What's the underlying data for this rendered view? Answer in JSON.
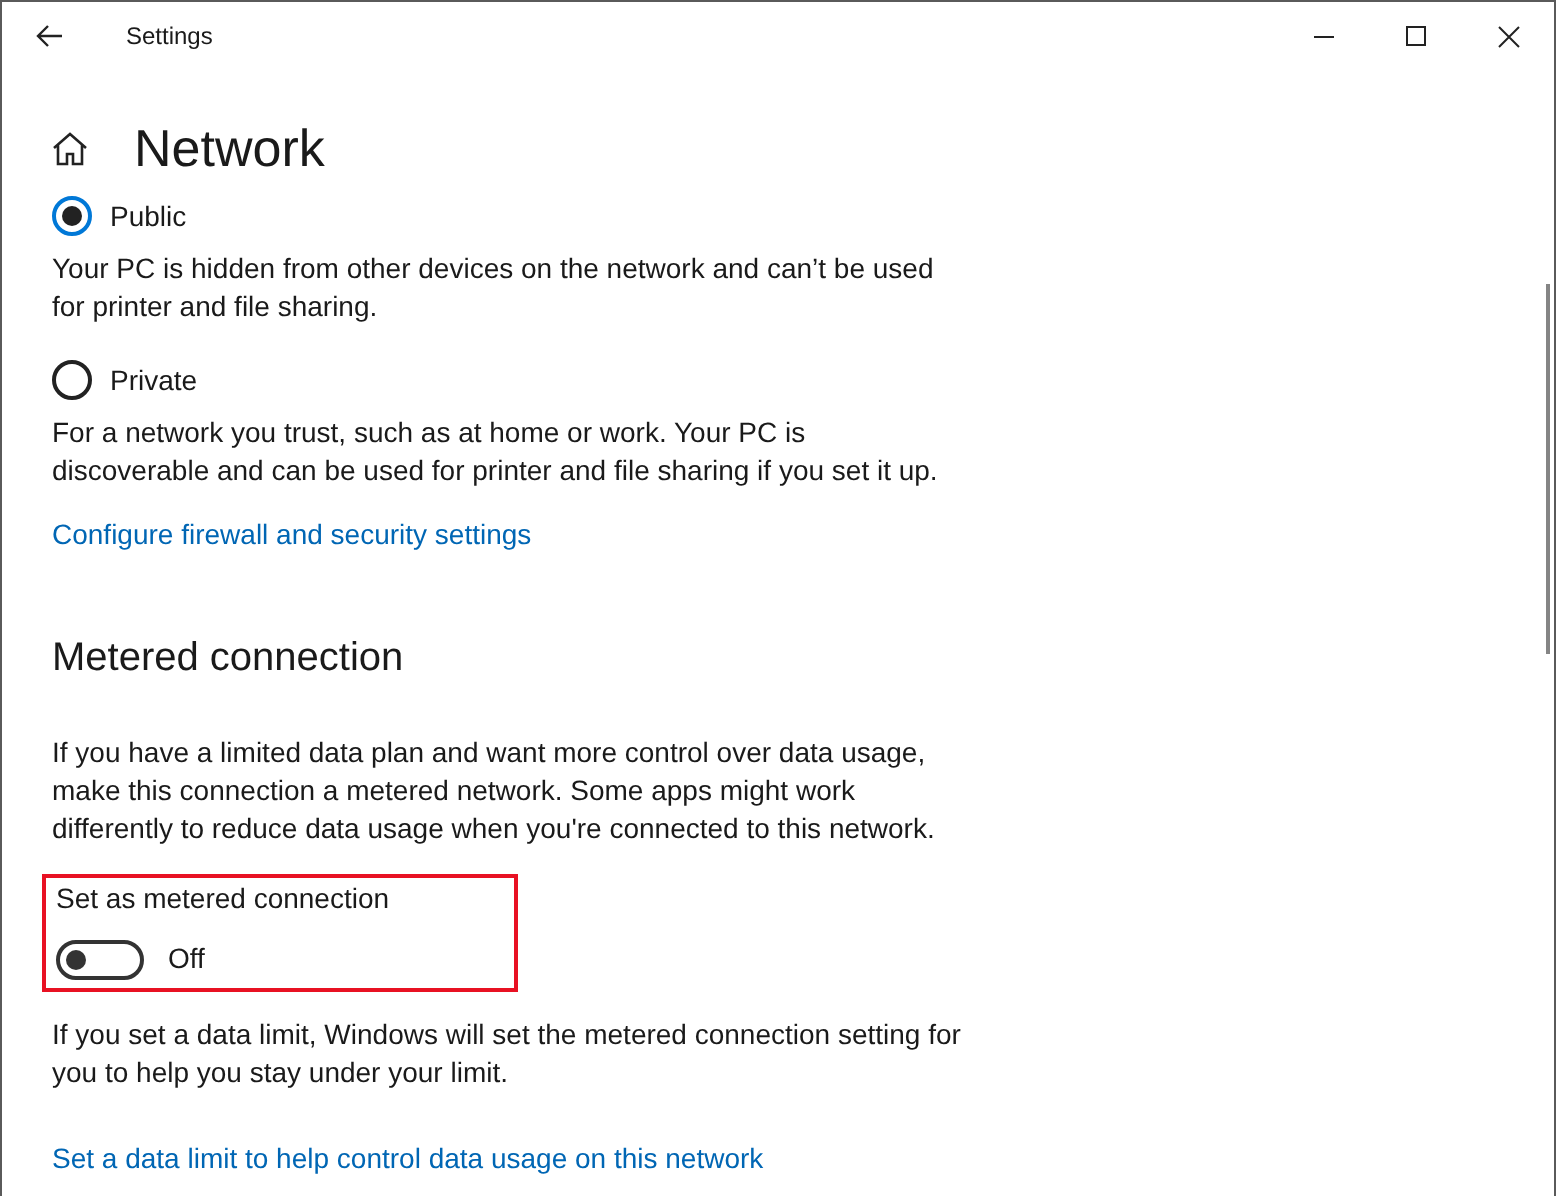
{
  "window": {
    "title": "Settings"
  },
  "page": {
    "title": "Network"
  },
  "network_profile": [
    {
      "label": "Public",
      "selected": true,
      "description": "Your PC is hidden from other devices on the network and can’t be used for printer and file sharing."
    },
    {
      "label": "Private",
      "selected": false,
      "description": "For a network you trust, such as at home or work. Your PC is discoverable and can be used for printer and file sharing if you set it up."
    }
  ],
  "firewall_link": "Configure firewall and security settings",
  "metered": {
    "heading": "Metered connection",
    "description": "If you have a limited data plan and want more control over data usage, make this connection a metered network. Some apps might work differently to reduce data usage when you're connected to this network.",
    "toggle": {
      "label": "Set as metered connection",
      "on": false,
      "state_text": "Off",
      "highlighted": true
    },
    "limit_note": "If you set a data limit, Windows will set the metered connection setting for you to help you stay under your limit.",
    "limit_link": "Set a data limit to help control data usage on this network"
  }
}
